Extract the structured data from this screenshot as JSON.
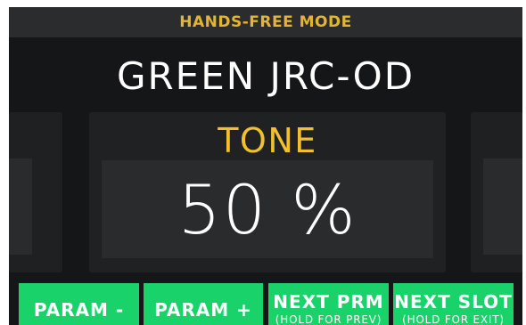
{
  "header": {
    "title": "HANDS-FREE MODE"
  },
  "model": {
    "name": "GREEN JRC-OD"
  },
  "parameter": {
    "name": "TONE",
    "value": "50 %"
  },
  "buttons": [
    {
      "label": "PARAM -",
      "sub": ""
    },
    {
      "label": "PARAM +",
      "sub": ""
    },
    {
      "label": "NEXT PRM",
      "sub": "(HOLD FOR PREV)"
    },
    {
      "label": "NEXT SLOT",
      "sub": "(HOLD FOR EXIT)"
    }
  ],
  "colors": {
    "accent_yellow": "#f0c12b",
    "button_green": "#19d36a",
    "background": "#151617"
  }
}
